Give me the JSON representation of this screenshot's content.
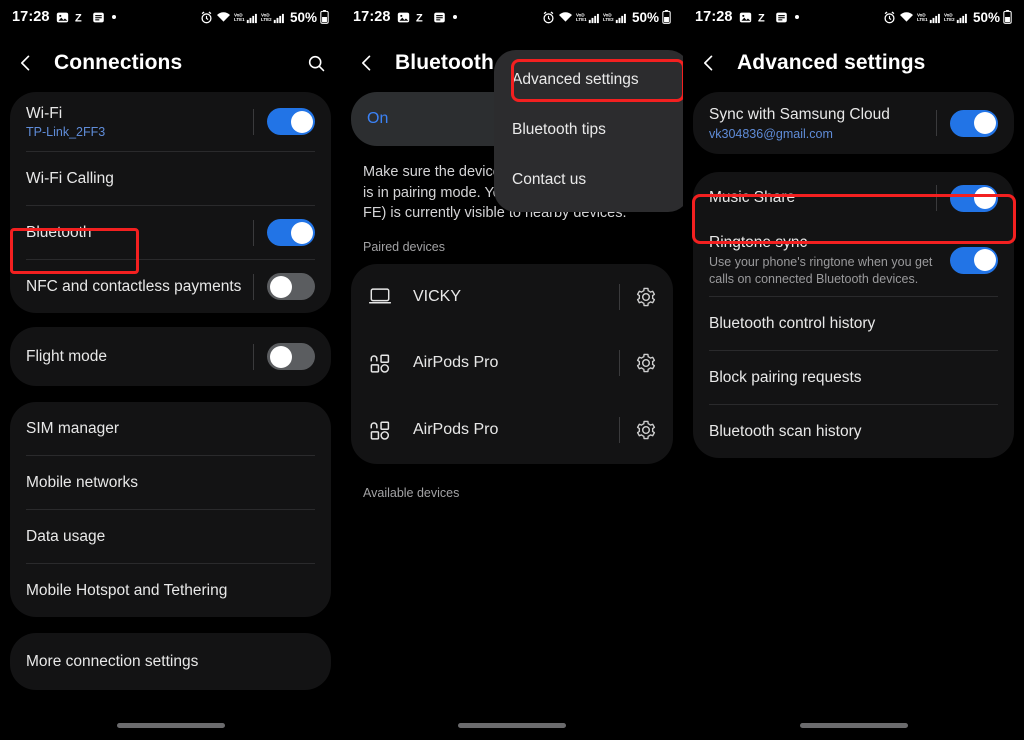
{
  "status_bar": {
    "time": "17:28",
    "left_icons": [
      "image-icon",
      "z-app-icon",
      "document-icon",
      "dot-icon"
    ],
    "right_icons": [
      "alarm-icon",
      "wifi-icon",
      "volte1-signal-icon",
      "volte2-signal-icon"
    ],
    "battery_percent": "50%"
  },
  "panel1": {
    "header": {
      "title": "Connections",
      "back_icon": "back-chevron-icon",
      "search_icon": "search-icon"
    },
    "group1": [
      {
        "title": "Wi-Fi",
        "sub": "TP-Link_2FF3",
        "toggle": "on"
      },
      {
        "title": "Wi-Fi Calling",
        "sub": "",
        "toggle": "none"
      },
      {
        "title": "Bluetooth",
        "sub": "",
        "toggle": "on",
        "highlighted": true
      },
      {
        "title": "NFC and contactless payments",
        "sub": "",
        "toggle": "off"
      }
    ],
    "group2": [
      {
        "title": "Flight mode",
        "sub": "",
        "toggle": "off"
      }
    ],
    "group3": [
      {
        "title": "SIM manager",
        "sub": "",
        "toggle": "none"
      },
      {
        "title": "Mobile networks",
        "sub": "",
        "toggle": "none"
      },
      {
        "title": "Data usage",
        "sub": "",
        "toggle": "none"
      },
      {
        "title": "Mobile Hotspot and Tethering",
        "sub": "",
        "toggle": "none"
      }
    ],
    "group4": [
      {
        "title": "More connection settings",
        "sub": "",
        "toggle": "none"
      }
    ]
  },
  "panel2": {
    "header": {
      "title": "Bluetooth",
      "back_icon": "back-chevron-icon"
    },
    "state_label": "On",
    "description": "Make sure the device you want to connect to is in pairing mode. Your phone (Vicky's S21 FE) is currently visible to nearby devices.",
    "menu": {
      "items": [
        {
          "label": "Advanced settings",
          "highlighted": true
        },
        {
          "label": "Bluetooth tips",
          "highlighted": false
        },
        {
          "label": "Contact us",
          "highlighted": false
        }
      ]
    },
    "paired_label": "Paired devices",
    "paired_devices": [
      {
        "name": "VICKY",
        "icon": "laptop-icon",
        "gear": "gear-icon"
      },
      {
        "name": "AirPods Pro",
        "icon": "earbuds-icon",
        "gear": "gear-icon"
      },
      {
        "name": "AirPods Pro",
        "icon": "earbuds-icon",
        "gear": "gear-icon"
      }
    ],
    "available_label": "Available devices"
  },
  "panel3": {
    "header": {
      "title": "Advanced settings",
      "back_icon": "back-chevron-icon"
    },
    "group1": [
      {
        "title": "Sync with Samsung Cloud",
        "sub": "vk304836@gmail.com",
        "toggle": "on"
      }
    ],
    "group2": [
      {
        "title": "Music Share",
        "sub": "",
        "toggle": "on",
        "highlighted": true
      },
      {
        "title": "Ringtone sync",
        "sub": "Use your phone's ringtone when you get calls on connected Bluetooth devices.",
        "toggle": "on"
      },
      {
        "title": "Bluetooth control history",
        "sub": "",
        "toggle": "none"
      },
      {
        "title": "Block pairing requests",
        "sub": "",
        "toggle": "none"
      },
      {
        "title": "Bluetooth scan history",
        "sub": "",
        "toggle": "none"
      }
    ]
  },
  "colors": {
    "background": "#000000",
    "card": "#131314",
    "card_light": "#2c2e30",
    "accent_blue": "#2274e6",
    "link_blue": "#5f8cd8",
    "highlight_red": "#f32020",
    "text_primary": "#e8e8e8",
    "text_secondary": "#9a9a9c"
  }
}
